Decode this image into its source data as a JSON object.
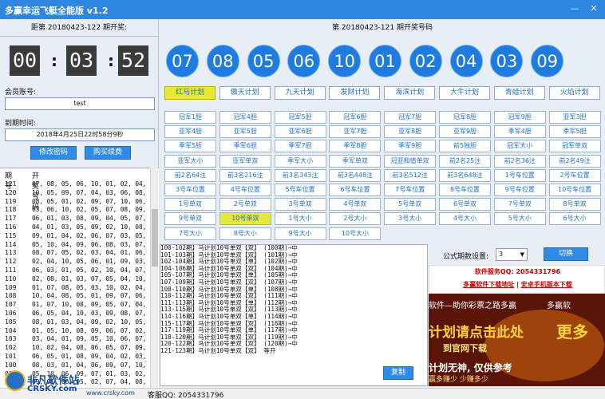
{
  "window": {
    "title": "多赢幸运飞艇全能版 v1.2"
  },
  "left": {
    "next_label": "距第 20180423-122 期开奖:",
    "countdown": {
      "h": "00",
      "m": "03",
      "s": "52"
    },
    "member_label": "会员账号:",
    "member_value": "test",
    "expire_label": "到期时间:",
    "expire_value": "2018年4月25日22时58分9秒",
    "change_pwd": "修改密码",
    "buy_renew": "购买续费",
    "list_headers": {
      "issue": "期号",
      "numbers": "开奖号码"
    },
    "rows": [
      {
        "n": "121",
        "v": "07, 08, 05, 06, 10, 01, 02, 04, 03, 09"
      },
      {
        "n": "120",
        "v": "10, 05, 09, 07, 04, 03, 06, 08, 02, 01"
      },
      {
        "n": "119",
        "v": "08, 05, 01, 02, 09, 07, 10, 06, 03, 04"
      },
      {
        "n": "118",
        "v": "03, 06, 10, 02, 05, 07, 08, 09, 04, 01"
      },
      {
        "n": "117",
        "v": "06, 01, 03, 08, 09, 04, 05, 07, 10, 02"
      },
      {
        "n": "116",
        "v": "04, 01, 03, 05, 09, 02, 10, 08, 07, 06"
      },
      {
        "n": "115",
        "v": "09, 01, 04, 02, 06, 07, 03, 05, 10, 08"
      },
      {
        "n": "114",
        "v": "05, 10, 04, 09, 06, 08, 03, 07, 02, 01"
      },
      {
        "n": "113",
        "v": "08, 07, 05, 02, 03, 04, 01, 06, 09, 10"
      },
      {
        "n": "112",
        "v": "02, 04, 10, 05, 06, 01, 09, 03, 08, 07"
      },
      {
        "n": "111",
        "v": "06, 03, 01, 05, 02, 10, 04, 07, 08, 09"
      },
      {
        "n": "110",
        "v": "02, 08, 01, 03, 07, 05, 04, 10, 06, 09"
      },
      {
        "n": "109",
        "v": "01, 07, 08, 05, 03, 10, 02, 04, 09, 06"
      },
      {
        "n": "108",
        "v": "10, 04, 08, 05, 01, 09, 07, 06, 03, 02"
      },
      {
        "n": "107",
        "v": "01, 07, 10, 08, 09, 05, 07, 04, 02, 03"
      },
      {
        "n": "106",
        "v": "06, 05, 04, 10, 03, 09, 08, 07, 01, 02"
      },
      {
        "n": "105",
        "v": "08, 01, 03, 04, 09, 02, 10, 05, 06, 07"
      },
      {
        "n": "104",
        "v": "01, 05, 10, 08, 09, 06, 07, 02, 03, 04"
      },
      {
        "n": "103",
        "v": "03, 04, 01, 09, 05, 10, 06, 07, 08, 02"
      },
      {
        "n": "102",
        "v": "10, 02, 04, 08, 06, 05, 07, 09, 03, 01"
      },
      {
        "n": "101",
        "v": "06, 05, 01, 08, 09, 04, 02, 03, 10, 07"
      },
      {
        "n": "100",
        "v": "08, 03, 01, 04, 06, 09, 07, 10, 05, 02"
      },
      {
        "n": "099",
        "v": "05, 10, 06, 09, 07, 01, 03, 02, 08, 04"
      },
      {
        "n": "098",
        "v": "09, 01, 06, 05, 02, 07, 04, 08, 03, 10"
      }
    ]
  },
  "right": {
    "draw_label": "第 20180423-121 期开奖号码",
    "balls": [
      "07",
      "08",
      "05",
      "06",
      "10",
      "01",
      "02",
      "04",
      "03",
      "09"
    ],
    "plans": [
      "红马计划",
      "傲天计划",
      "九天计划",
      "发财计划",
      "海滨计划",
      "大牛计划",
      "青蛙计划",
      "火焰计划"
    ],
    "grid": [
      [
        "冠军1胆",
        "冠军4胆",
        "冠军5胆",
        "冠军6胆",
        "冠军7胆",
        "冠军8胆",
        "冠军9胆",
        "亚军3胆"
      ],
      [
        "亚军4胆",
        "亚军5胆",
        "亚军6胆",
        "亚军7胆",
        "亚军8胆",
        "亚军9胆",
        "季军4胆",
        "季军5胆"
      ],
      [
        "季军5胆",
        "季军6胆",
        "季军7胆",
        "季军8胆",
        "季军9胆",
        "前5独胆",
        "冠军大小",
        "冠军单双"
      ],
      [
        "亚军大小",
        "亚军单双",
        "季军大小",
        "季军单双",
        "冠亚和值单双",
        "前2名25注",
        "前2名36注",
        "前2名49注"
      ],
      [
        "前2名64注",
        "前3名216注",
        "前3名343注",
        "前3名448注",
        "前3名512注",
        "前3名648注",
        "1号车位置",
        "2号车位置"
      ],
      [
        "3号车位置",
        "4号车位置",
        "5号车位置",
        "6号车位置",
        "7号车位置",
        "8号车位置",
        "9号车位置",
        "10号车位置"
      ],
      [
        "1号单双",
        "2号单双",
        "3号单双",
        "4号单双",
        "5号单双",
        "6号单双",
        "7号单双",
        "8号单双"
      ],
      [
        "9号单双",
        "10号单双",
        "1号大小",
        "2号大小",
        "3号大小",
        "4号大小",
        "5号大小",
        "6号大小"
      ],
      [
        "7号大小",
        "8号大小",
        "9号大小",
        "10号大小",
        "",
        "",
        "",
        ""
      ]
    ],
    "log": [
      "100-102期】马计划10号单双【双】 (100期)→中",
      "101-103期】马计划10号单双【双】 (101期)→中",
      "102-104期】马计划10号单双【单】 (102期)→中",
      "104-106期】马计划10号单双【双】 (104期)→中",
      "105-107期】马计划10号单双【单】 (105期)→中",
      "107-109期】马计划10号单双【双】 (107期)→中",
      "108-110期】马计划10号单双【单】 (108期)→中",
      "110-112期】马计划10号单双【双】 (111期)→中",
      "111-113期】马计划10号单双【单】 (112期)→中",
      "113-115期】马计划10号单双【双】 (113期)→中",
      "114-116期】马计划10号单双【单】 (114期)→中",
      "115-117期】马计划10号单双【双】 (116期)→中",
      "117-119期】马计划10号单双【单】 (117期)→中",
      "118-120期】马计划10号单双【双】 (119期)→中",
      "120-122期】马计划10号单双【双】 (120期)→中",
      "121-123期】马计划10号单双【双】 等开"
    ],
    "copy": "复制",
    "formula_label": "公式期数设置:",
    "formula_value": "3",
    "switch": "切换",
    "service_qq": "软件服务QQ: 2054331796",
    "dl_link": "多赢软件下载地址",
    "mobile_link": "安卓手机版本下载",
    "banner": {
      "t1": "软件—助你彩票之路多赢",
      "t2": "多赢软",
      "t3": "计划请点击此处",
      "t4": "更多",
      "t5": "到官网下载",
      "t6": "计划无神, 仅供参考",
      "t7": "赢多赚少 少赚多少"
    }
  },
  "status": {
    "qq": "客服QQ: 2054331796",
    "site": "www.crsky.com"
  },
  "logo": {
    "l1": "非凡软件站",
    "l2": "CRSKY.com"
  }
}
